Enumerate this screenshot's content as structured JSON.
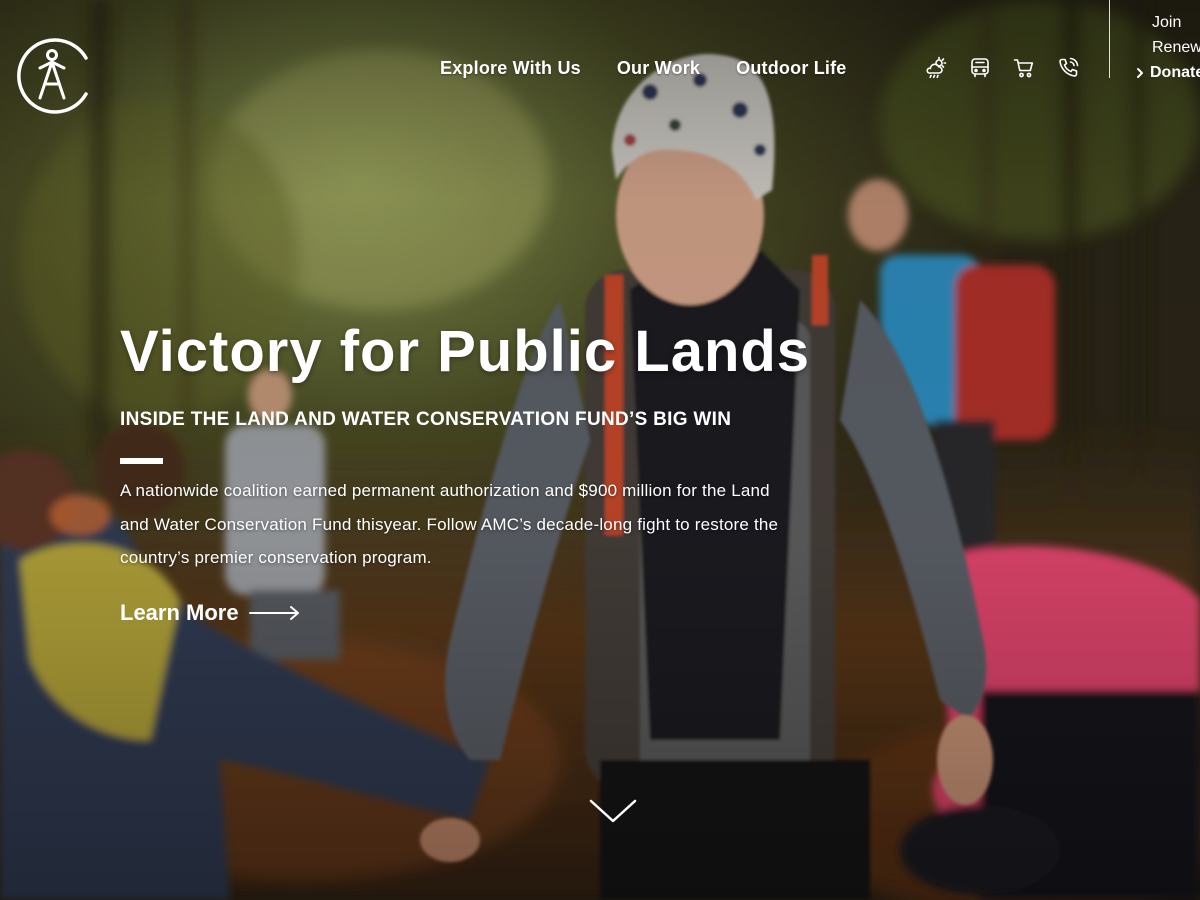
{
  "colors": {
    "text": "#ffffff",
    "accent_red": "#d2452c",
    "accent_pink": "#f0436a"
  },
  "logo": {
    "name": "amc-logo-icon"
  },
  "nav": {
    "items": [
      {
        "label": "Explore With Us"
      },
      {
        "label": "Our Work"
      },
      {
        "label": "Outdoor Life"
      }
    ]
  },
  "utility_icons": [
    "weather-icon",
    "bus-icon",
    "cart-icon",
    "phone-icon"
  ],
  "utility_links": {
    "join": "Join",
    "renew": "Renew",
    "donate": "Donate"
  },
  "hero": {
    "title": "Victory for Public Lands",
    "subtitle": "INSIDE THE LAND AND WATER CONSERVATION FUND’S BIG WIN",
    "body_lines": [
      "A nationwide coalition earned permanent authorization and $900 million for the Land",
      "and Water Conservation Fund thisyear. Follow AMC’s decade-long fight to restore the",
      "country’s premier conservation program."
    ],
    "cta_label": "Learn More",
    "cta_icon": "arrow-right-icon",
    "scroll_icon": "chevron-down-icon"
  }
}
